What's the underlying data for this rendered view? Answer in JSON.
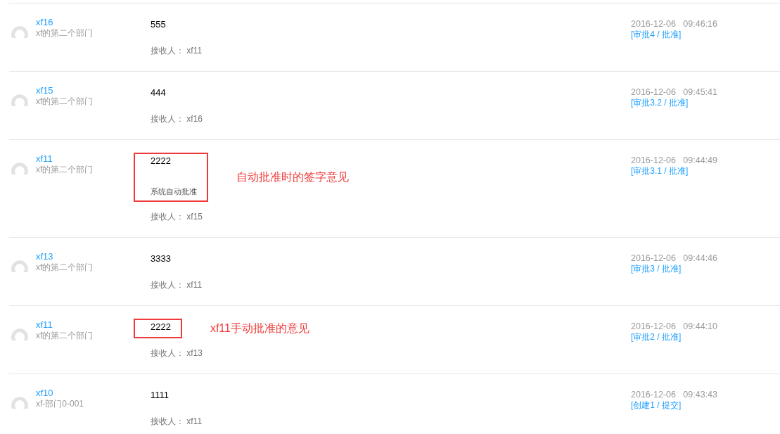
{
  "records": [
    {
      "name": "xf16",
      "department": "xf的第二个部门",
      "comment": "555",
      "recipient": "接收人： xf11",
      "time": "2016-12-06   09:46:16",
      "step": "[审批4 / 批准]"
    },
    {
      "name": "xf15",
      "department": "xf的第二个部门",
      "comment": "444",
      "recipient": "接收人： xf16",
      "time": "2016-12-06   09:45:41",
      "step": "[审批3.2 / 批准]"
    },
    {
      "name": "xf11",
      "department": "xf的第二个部门",
      "comment": "2222",
      "note": "系统自动批准",
      "recipient": "接收人： xf15",
      "time": "2016-12-06   09:44:49",
      "step": "[审批3.1 / 批准]",
      "annotation": "自动批准时的签字意见"
    },
    {
      "name": "xf13",
      "department": "xf的第二个部门",
      "comment": "3333",
      "recipient": "接收人： xf11",
      "time": "2016-12-06   09:44:46",
      "step": "[审批3 / 批准]"
    },
    {
      "name": "xf11",
      "department": "xf的第二个部门",
      "comment": "2222",
      "recipient": "接收人： xf13",
      "time": "2016-12-06   09:44:10",
      "step": "[审批2 / 批准]",
      "annotation": "xf11手动批准的意见"
    },
    {
      "name": "xf10",
      "department": "xf-部门0-001",
      "comment": "1111",
      "recipient": "接收人： xf11",
      "time": "2016-12-06   09:43:43",
      "step": "[创建1 / 提交]"
    }
  ]
}
